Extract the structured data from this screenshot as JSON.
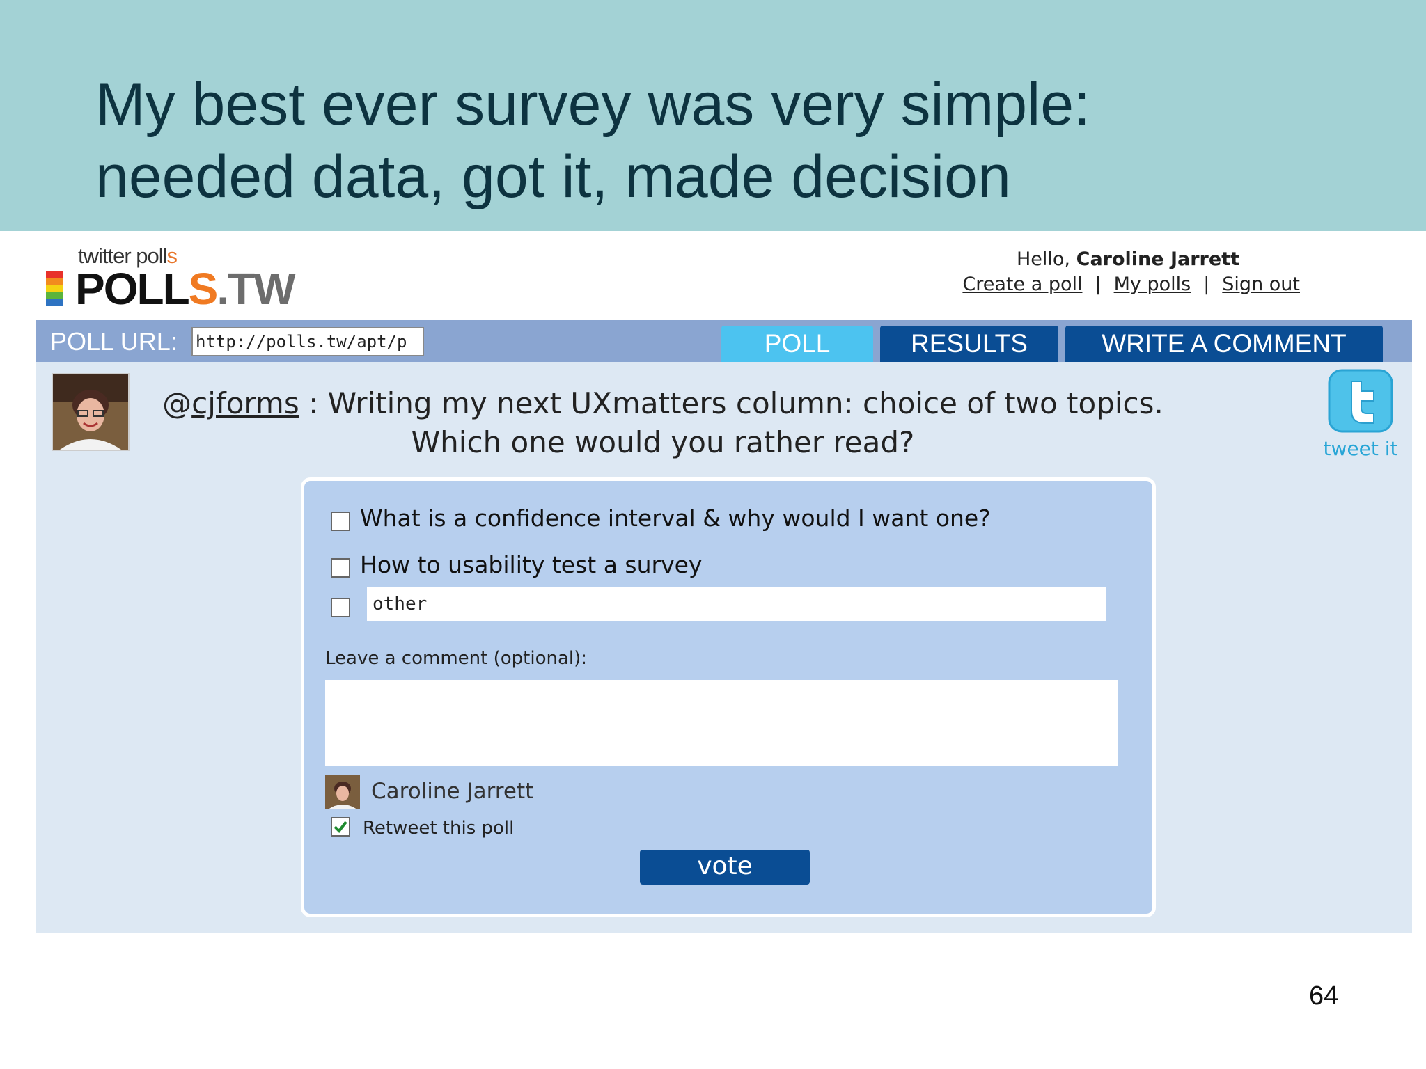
{
  "slide": {
    "title_line1": "My best ever survey was very simple:",
    "title_line2": "needed data, got it, made decision",
    "page_number": "64"
  },
  "site": {
    "logo_small": "twitter poll",
    "logo_small_accent": "s",
    "logo_main_a": "POLL",
    "logo_main_s": "S",
    "logo_main_tw": ".TW",
    "greeting_prefix": "Hello,",
    "user_name": "Caroline Jarrett",
    "links": [
      "Create a poll",
      "My polls",
      "Sign out"
    ]
  },
  "navbar": {
    "url_label": "POLL URL:",
    "url_value": "http://polls.tw/apt/p",
    "tabs": [
      "POLL",
      "RESULTS",
      "WRITE A COMMENT"
    ]
  },
  "poll": {
    "handle_at": "@",
    "handle": "cjforms",
    "question": " : Writing my next UXmatters column: choice of two topics. Which one would you rather read?",
    "tweet_label": "tweet it",
    "options": [
      "What is a confidence interval & why would I want one?",
      "How to usability test a survey"
    ],
    "other_placeholder": "other",
    "comment_label": "Leave a comment (optional):",
    "commenter_name": "Caroline Jarrett",
    "retweet_label": "Retweet this poll",
    "retweet_checked": true,
    "vote_label": "vote"
  },
  "colors": {
    "header_band": "#a3d2d5",
    "navbar": "#8aa5d1",
    "tab_active": "#4cc3f0",
    "tab_inactive": "#0a4d94",
    "panel": "#b7cfee"
  }
}
